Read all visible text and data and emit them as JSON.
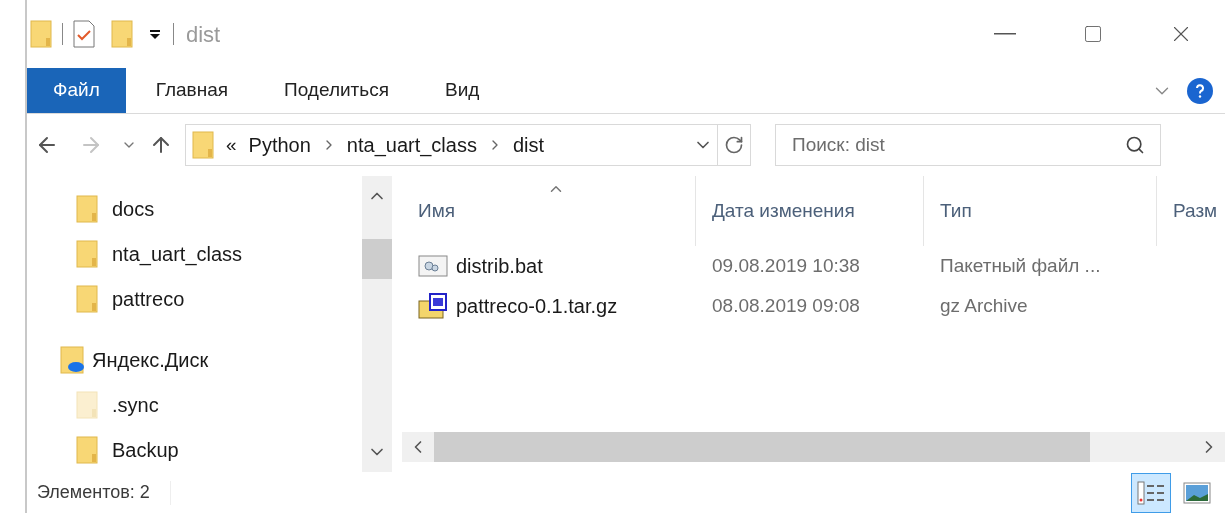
{
  "window": {
    "title": "dist"
  },
  "ribbon_tabs": [
    {
      "label": "Файл",
      "selected": true
    },
    {
      "label": "Главная",
      "selected": false
    },
    {
      "label": "Поделиться",
      "selected": false
    },
    {
      "label": "Вид",
      "selected": false
    }
  ],
  "address": {
    "overflow": "«",
    "crumbs": [
      "Python",
      "nta_uart_class",
      "dist"
    ]
  },
  "search": {
    "placeholder": "Поиск: dist"
  },
  "sidebar": {
    "items": [
      {
        "label": "docs",
        "kind": "folder",
        "hidden": false
      },
      {
        "label": "nta_uart_class",
        "kind": "folder",
        "hidden": false
      },
      {
        "label": "pattreco",
        "kind": "folder",
        "hidden": false
      },
      {
        "label": "Яндекс.Диск",
        "kind": "cloud",
        "hidden": false
      },
      {
        "label": ".sync",
        "kind": "folder",
        "hidden": true
      },
      {
        "label": "Backup",
        "kind": "folder",
        "hidden": false
      }
    ]
  },
  "table": {
    "columns": [
      "Имя",
      "Дата изменения",
      "Тип",
      "Разм"
    ],
    "rows": [
      {
        "kind": "batch",
        "cells": [
          "distrib.bat",
          "09.08.2019 10:38",
          "Пакетный файл ..."
        ]
      },
      {
        "kind": "archive",
        "cells": [
          "pattreco-0.1.tar.gz",
          "08.08.2019 09:08",
          "gz Archive"
        ]
      }
    ]
  },
  "status_bar": {
    "text": "Элементов: 2"
  },
  "views": [
    {
      "kind": "details",
      "selected": true
    },
    {
      "kind": "thumbnails",
      "selected": false
    }
  ]
}
